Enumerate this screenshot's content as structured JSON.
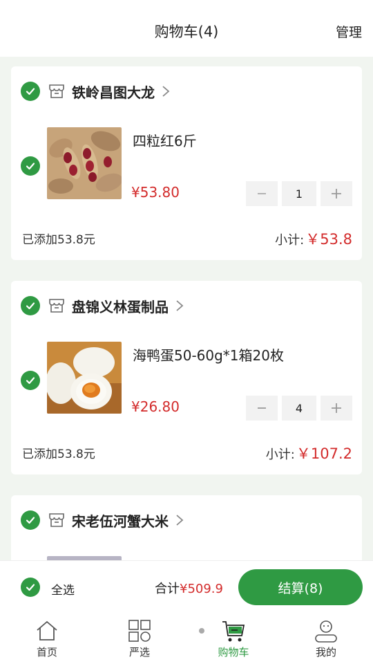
{
  "header": {
    "title": "购物车(4)",
    "manage_label": "管理"
  },
  "colors": {
    "accent": "#2f9a43",
    "price": "#d32b2b"
  },
  "cart": [
    {
      "store": "铁岭昌图大龙",
      "product": "四粒红6斤",
      "price": "¥53.80",
      "quantity": "1",
      "added": "已添加53.8元",
      "subtotal_label": "小计:",
      "subtotal_value": "￥53.8",
      "image": "peanuts-photo"
    },
    {
      "store": "盘锦义林蛋制品",
      "product": "海鸭蛋50-60g*1箱20枚",
      "price": "¥26.80",
      "quantity": "4",
      "added": "已添加53.8元",
      "subtotal_label": "小计:",
      "subtotal_value": "￥107.2",
      "image": "salted-duck-egg-photo"
    },
    {
      "store": "宋老伍河蟹大米"
    }
  ],
  "footer": {
    "select_all": "全选",
    "total_label": "合计",
    "total_value": "¥509.9",
    "checkout_label": "结算(8)"
  },
  "tabs": [
    {
      "label": "首页",
      "icon": "home-icon"
    },
    {
      "label": "严选",
      "icon": "grid-icon"
    },
    {
      "label": "购物车",
      "icon": "cart-icon",
      "active": true
    },
    {
      "label": "我的",
      "icon": "profile-icon"
    }
  ]
}
